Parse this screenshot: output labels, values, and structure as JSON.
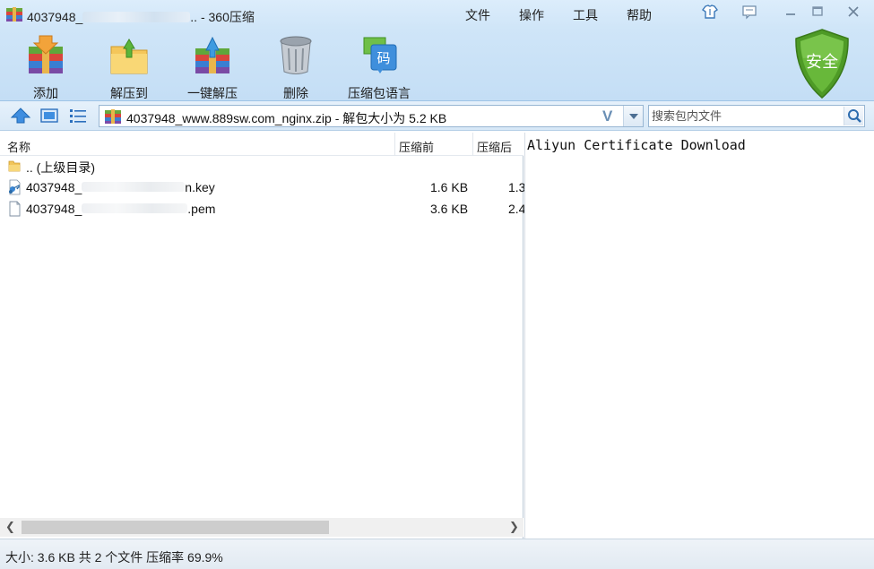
{
  "window": {
    "title_prefix": "4037948_",
    "title_suffix": ".. - 360压缩"
  },
  "menu": {
    "items": [
      "文件",
      "操作",
      "工具",
      "帮助"
    ]
  },
  "toolbar": {
    "add_label": "添加",
    "extract_to_label": "解压到",
    "one_click_extract_label": "一键解压",
    "delete_label": "删除",
    "language_label": "压缩包语言",
    "language_icon_glyph": "码",
    "security_label": "安全"
  },
  "address": {
    "path": "4037948_www.889sw.com_nginx.zip - 解包大小为 5.2 KB",
    "v_mark": "V"
  },
  "search": {
    "placeholder": "搜索包内文件"
  },
  "list": {
    "columns": [
      "名称",
      "压缩前",
      "压缩后"
    ],
    "rows": [
      {
        "icon": "folder-icon",
        "name": ".. (上级目录)",
        "before": "",
        "after": ""
      },
      {
        "icon": "key-file-icon",
        "name_prefix": "4037948_",
        "name_suffix": "n.key",
        "before": "1.6 KB",
        "after": "1.3"
      },
      {
        "icon": "file-icon",
        "name_prefix": "4037948_",
        "name_suffix": ".pem",
        "before": "3.6 KB",
        "after": "2.4"
      }
    ]
  },
  "preview": {
    "text": "Aliyun Certificate Download"
  },
  "status": {
    "text": "大小: 3.6 KB 共 2 个文件 压缩率 69.9%"
  },
  "colors": {
    "header_bg": "#cfe5f8",
    "shield_green": "#5aa52d",
    "accent_blue": "#2f7fd0"
  }
}
